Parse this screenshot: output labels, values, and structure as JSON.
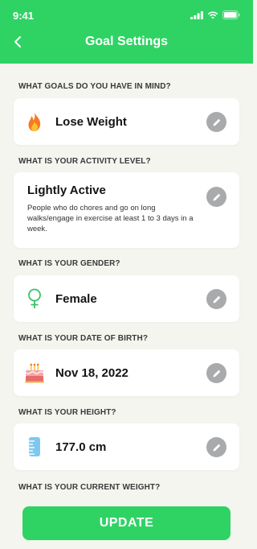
{
  "status_bar": {
    "time": "9:41"
  },
  "header": {
    "title": "Goal Settings"
  },
  "sections": {
    "goal": {
      "label": "WHAT GOALS DO YOU HAVE IN MIND?",
      "value": "Lose Weight"
    },
    "activity": {
      "label": "WHAT IS YOUR ACTIVITY LEVEL?",
      "value": "Lightly Active",
      "description": "People who do chores and go on long walks/engage in exercise at least 1 to 3 days in a week."
    },
    "gender": {
      "label": "WHAT IS YOUR GENDER?",
      "value": "Female"
    },
    "dob": {
      "label": "WHAT IS YOUR DATE OF BIRTH?",
      "value": "Nov 18, 2022"
    },
    "height": {
      "label": "WHAT IS YOUR HEIGHT?",
      "value": "177.0 cm"
    },
    "weight": {
      "label": "WHAT IS YOUR CURRENT WEIGHT?"
    }
  },
  "update_button": {
    "label": "UPDATE"
  },
  "icons": {
    "goal": "fire-icon",
    "gender": "female-icon",
    "dob": "cake-icon",
    "height": "ruler-icon",
    "edit": "pencil-icon"
  },
  "colors": {
    "accent": "#2fd364",
    "edit_button": "#a9aaac",
    "background": "#f4f5ef"
  }
}
